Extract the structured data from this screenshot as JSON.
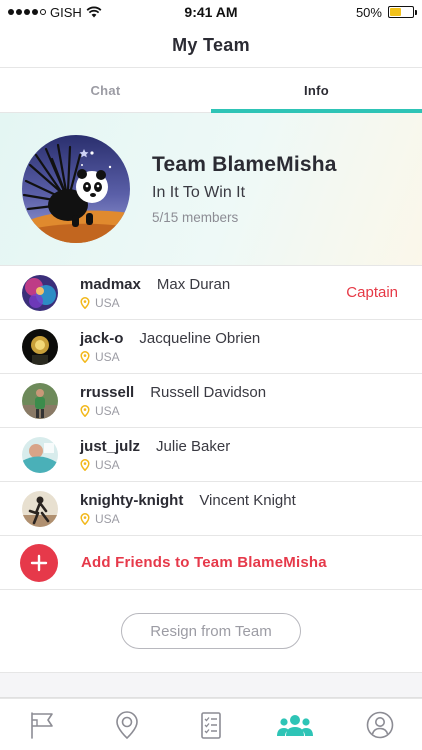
{
  "status_bar": {
    "carrier": "GISH",
    "time": "9:41 AM",
    "battery_percent": "50%",
    "battery_level": 0.5,
    "signal_bars": 4
  },
  "header": {
    "title": "My Team"
  },
  "tabs": [
    {
      "label": "Chat",
      "active": false
    },
    {
      "label": "Info",
      "active": true
    }
  ],
  "team": {
    "name": "Team BlameMisha",
    "motto": "In It To Win It",
    "members_count": "5/15 members"
  },
  "members": [
    {
      "username": "madmax",
      "full_name": "Max Duran",
      "location": "USA",
      "role": "Captain"
    },
    {
      "username": "jack-o",
      "full_name": "Jacqueline Obrien",
      "location": "USA",
      "role": ""
    },
    {
      "username": "rrussell",
      "full_name": "Russell Davidson",
      "location": "USA",
      "role": ""
    },
    {
      "username": "just_julz",
      "full_name": "Julie Baker",
      "location": "USA",
      "role": ""
    },
    {
      "username": "knighty-knight",
      "full_name": "Vincent Knight",
      "location": "USA",
      "role": ""
    }
  ],
  "add_friends": {
    "label": "Add Friends to Team BlameMisha"
  },
  "resign": {
    "label": "Resign from Team"
  },
  "bottom_tabs": [
    {
      "icon": "flag-icon",
      "active": false
    },
    {
      "icon": "map-pin-icon",
      "active": false
    },
    {
      "icon": "checklist-icon",
      "active": false
    },
    {
      "icon": "team-icon",
      "active": true
    },
    {
      "icon": "profile-icon",
      "active": false
    }
  ],
  "colors": {
    "accent_teal": "#2ec4b6",
    "accent_red": "#e6394a",
    "battery_yellow": "#f2c21b",
    "pin_yellow": "#f2b81b"
  }
}
